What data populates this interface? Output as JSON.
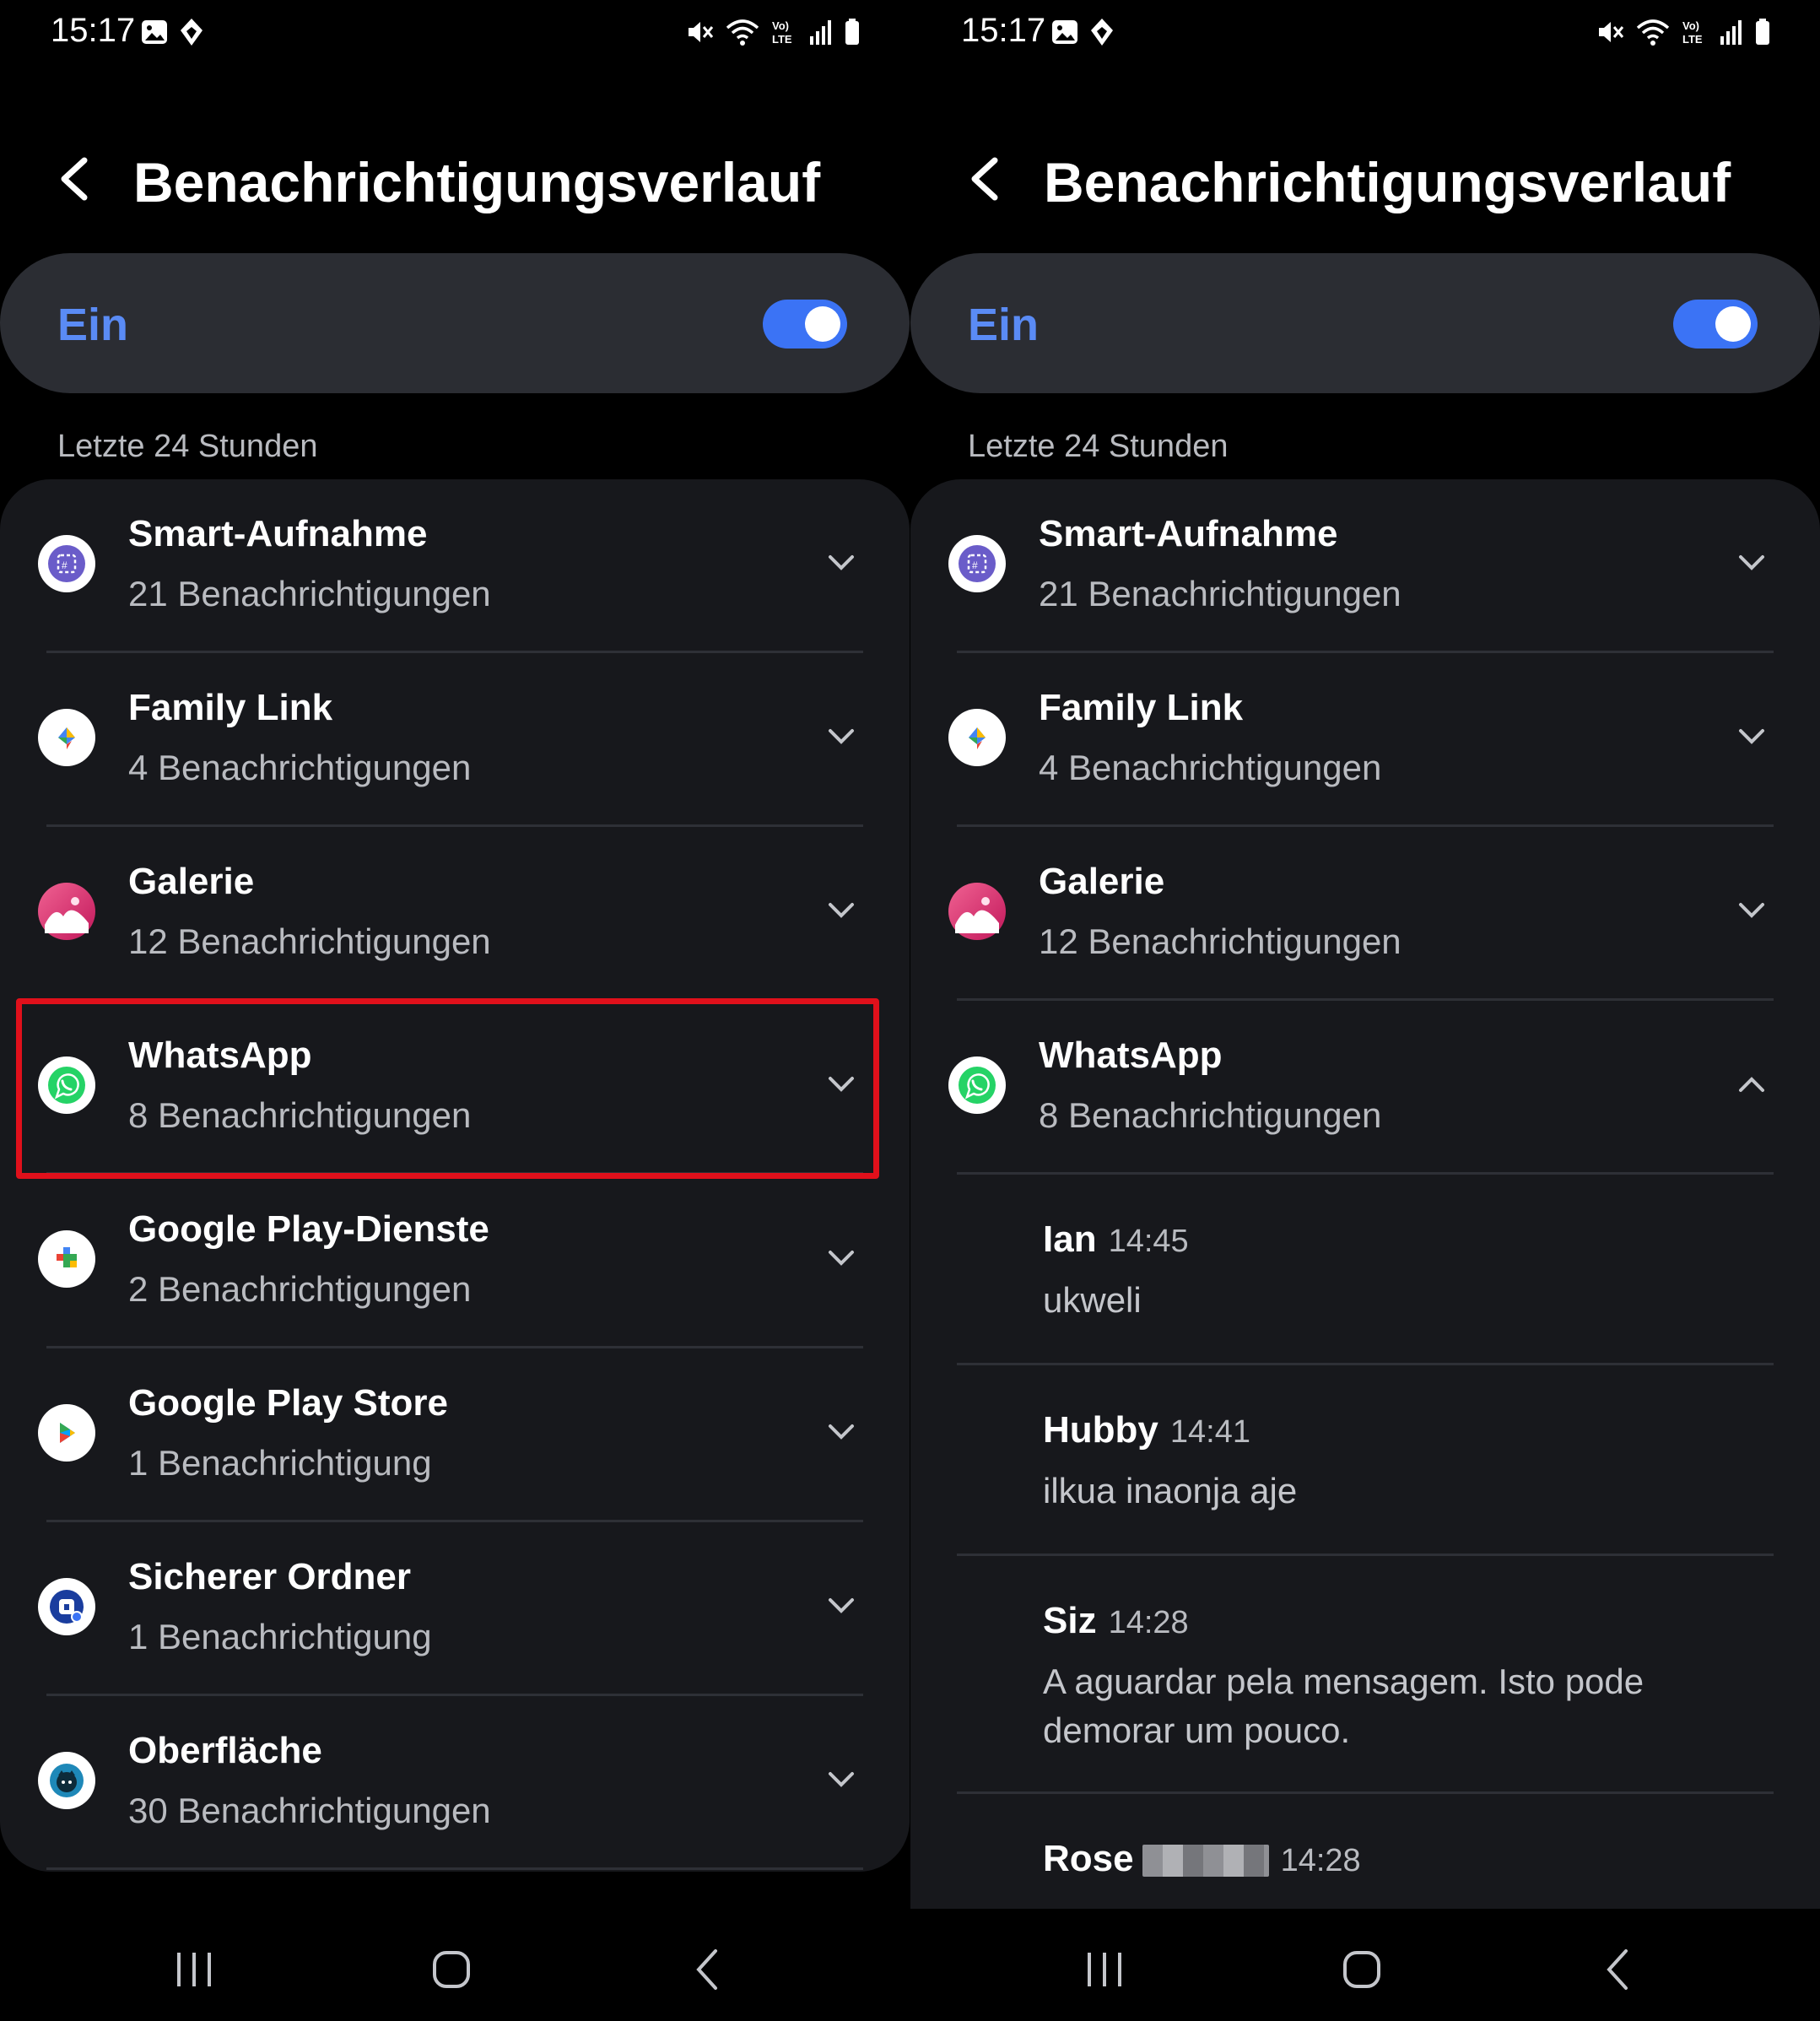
{
  "status_bar": {
    "time": "15:17"
  },
  "header": {
    "title": "Benachrichtigungsverlauf"
  },
  "master_switch": {
    "label": "Ein",
    "on": true
  },
  "section": {
    "label": "Letzte 24 Stunden"
  },
  "apps": [
    {
      "name": "Smart-Aufnahme",
      "count": "21 Benachrichtigungen",
      "icon": "smart-capture-icon"
    },
    {
      "name": "Family Link",
      "count": "4 Benachrichtigungen",
      "icon": "family-link-icon"
    },
    {
      "name": "Galerie",
      "count": "12 Benachrichtigungen",
      "icon": "gallery-icon"
    },
    {
      "name": "WhatsApp",
      "count": "8 Benachrichtigungen",
      "icon": "whatsapp-icon"
    },
    {
      "name": "Google Play-Dienste",
      "count": "2 Benachrichtigungen",
      "icon": "google-play-services-icon"
    },
    {
      "name": "Google Play Store",
      "count": "1 Benachrichtigung",
      "icon": "google-play-store-icon"
    },
    {
      "name": "Sicherer Ordner",
      "count": "1 Benachrichtigung",
      "icon": "secure-folder-icon"
    },
    {
      "name": "Oberfläche",
      "count": "30 Benachrichtigungen",
      "icon": "one-ui-home-icon"
    }
  ],
  "whatsapp_notifications": [
    {
      "sender": "Ian",
      "time": "14:45",
      "text": "ukweli"
    },
    {
      "sender": "Hubby",
      "time": "14:41",
      "text": "ilkua inaonja aje"
    },
    {
      "sender": "Siz",
      "time": "14:28",
      "text": "A aguardar pela mensagem. Isto pode demorar um pouco."
    },
    {
      "sender": "Rose",
      "time": "14:28",
      "text": ""
    }
  ],
  "colors": {
    "accent": "#3b73f5",
    "highlight": "#e0101b",
    "card": "#17181c",
    "switch_card": "#2b2d33"
  }
}
